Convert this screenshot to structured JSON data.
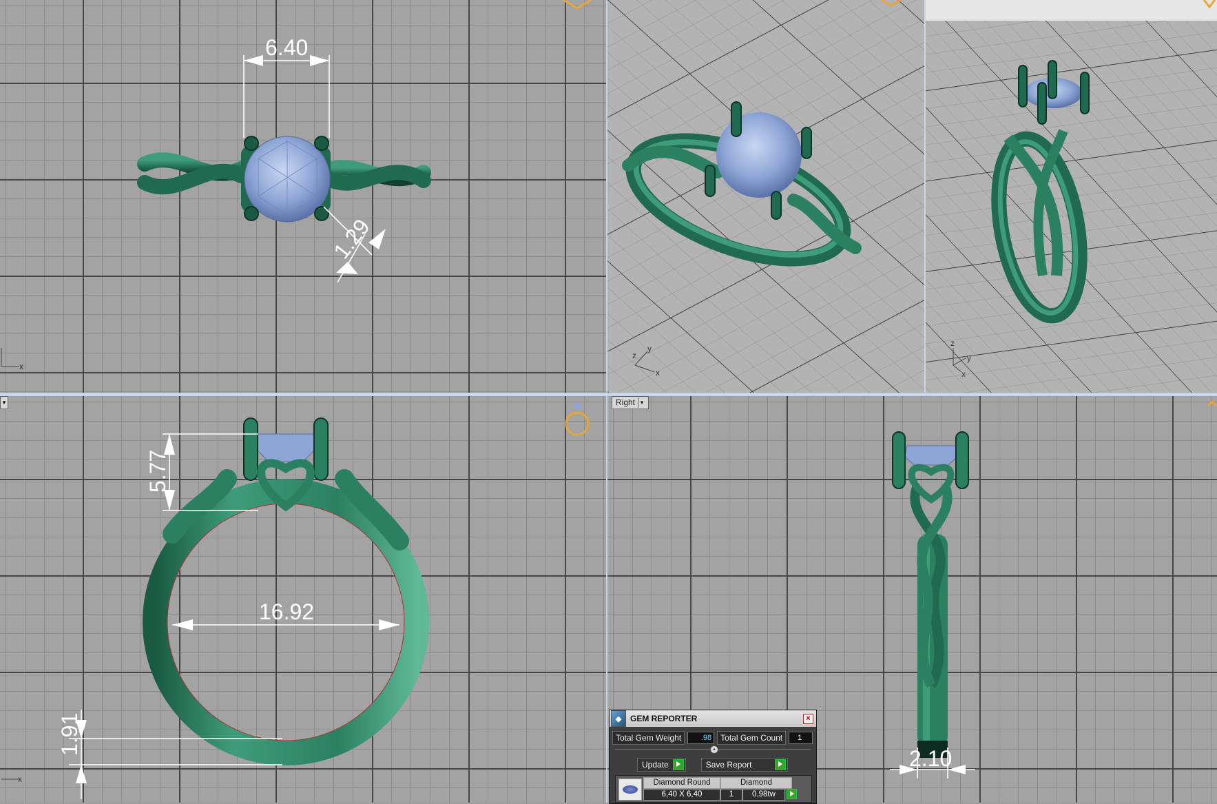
{
  "viewports": {
    "top": {
      "dimension_width": "6.40",
      "dimension_prong": "1.29"
    },
    "front": {
      "dimension_height": "5.77",
      "dimension_inner": "16.92",
      "dimension_band": "1.91"
    },
    "right": {
      "label": "Right",
      "dimension_band": "2.10"
    }
  },
  "axis": {
    "x": "x",
    "y": "y",
    "z": "z"
  },
  "gem_reporter": {
    "title": "GEM REPORTER",
    "total_weight_label": "Total Gem Weight",
    "total_weight_value": ".98",
    "total_count_label": "Total Gem Count",
    "total_count_value": "1",
    "update_label": "Update",
    "save_report_label": "Save Report",
    "table": {
      "col1_header": "Diamond Round",
      "col1_value": "6,40 X 6,40",
      "col2_header": "Diamond",
      "col2_count": "1",
      "col2_weight": "0,98tw"
    }
  },
  "colors": {
    "metal": "#2e7f63",
    "metal_dark": "#15503b",
    "gem": "#8ea6d6",
    "grid_bg": "#a3a3a3",
    "divider": "#c9d5e8"
  }
}
